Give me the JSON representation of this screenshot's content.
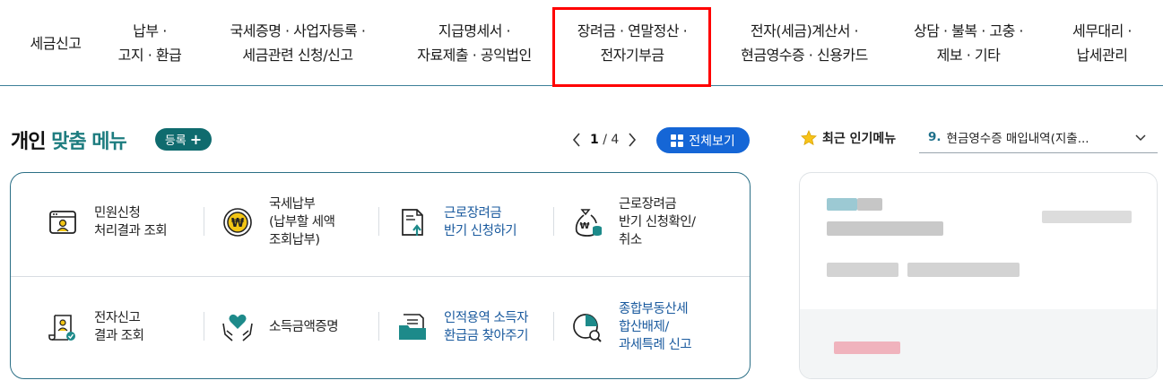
{
  "nav": {
    "items": [
      {
        "label": "세금신고"
      },
      {
        "label": "납부 ·\n고지 · 환급"
      },
      {
        "label": "국세증명 · 사업자등록 ·\n세금관련 신청/신고"
      },
      {
        "label": "지급명세서 ·\n자료제출 · 공익법인"
      },
      {
        "label": "장려금 · 연말정산 ·\n전자기부금"
      },
      {
        "label": "전자(세금)계산서 ·\n현금영수증 · 신용카드"
      },
      {
        "label": "상담 · 불복 · 고충 ·\n제보 · 기타"
      },
      {
        "label": "세무대리 ·\n납세관리"
      }
    ],
    "highlight_color": "#ff0000"
  },
  "custom_menu": {
    "title_prefix": "개인",
    "title_accent": "맞춤 메뉴",
    "register_label": "등록",
    "register_plus": "+",
    "pager": {
      "current": "1",
      "separator": "/",
      "total": "4",
      "prev": "‹",
      "next": "›"
    },
    "view_all_label": "전체보기",
    "items": [
      {
        "label": "민원신청\n처리결과 조회",
        "icon": "document-person-icon"
      },
      {
        "label": "국세납부\n(납부할 세액\n조회납부)",
        "icon": "won-coin-icon"
      },
      {
        "label": "근로장려금\n반기 신청하기",
        "icon": "document-upload-icon"
      },
      {
        "label": "근로장려금\n반기 신청확인/\n취소",
        "icon": "money-bag-icon"
      },
      {
        "label": "전자신고\n결과 조회",
        "icon": "scroll-check-icon"
      },
      {
        "label": "소득금액증명",
        "icon": "hands-heart-icon"
      },
      {
        "label": "인적용역 소득자\n환급금 찾아주기",
        "icon": "folder-icon"
      },
      {
        "label": "종합부동산세\n합산배제/\n과세특례 신고",
        "icon": "pie-search-icon"
      }
    ]
  },
  "popular_menu": {
    "title": "최근 인기메뉴",
    "selected_number": "9.",
    "selected_label": "현금영수증 매입내역(지출..."
  },
  "colors": {
    "accent_teal": "#1d7c7f",
    "register_bg": "#0f6b6e",
    "view_all_bg": "#1566d6",
    "link_blue": "#1a5a9e",
    "box_border": "#2b6f86"
  }
}
